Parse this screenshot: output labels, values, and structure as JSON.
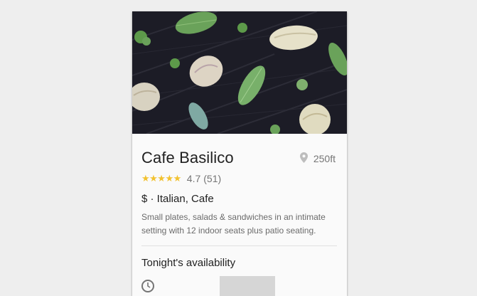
{
  "restaurant": {
    "name": "Cafe Basilico",
    "distance": "250ft",
    "stars": "★★★★★",
    "rating": "4.7",
    "review_count": "(51)",
    "price_category": "$ · Italian, Cafe",
    "description": "Small plates, salads & sandwiches in an intimate setting with 12 indoor seats plus patio seating."
  },
  "availability": {
    "title": "Tonight's availability"
  },
  "icons": {
    "location": "location-pin-icon",
    "clock": "clock-icon"
  },
  "colors": {
    "star": "#f2c230",
    "hero_background": "#1c1c26"
  }
}
